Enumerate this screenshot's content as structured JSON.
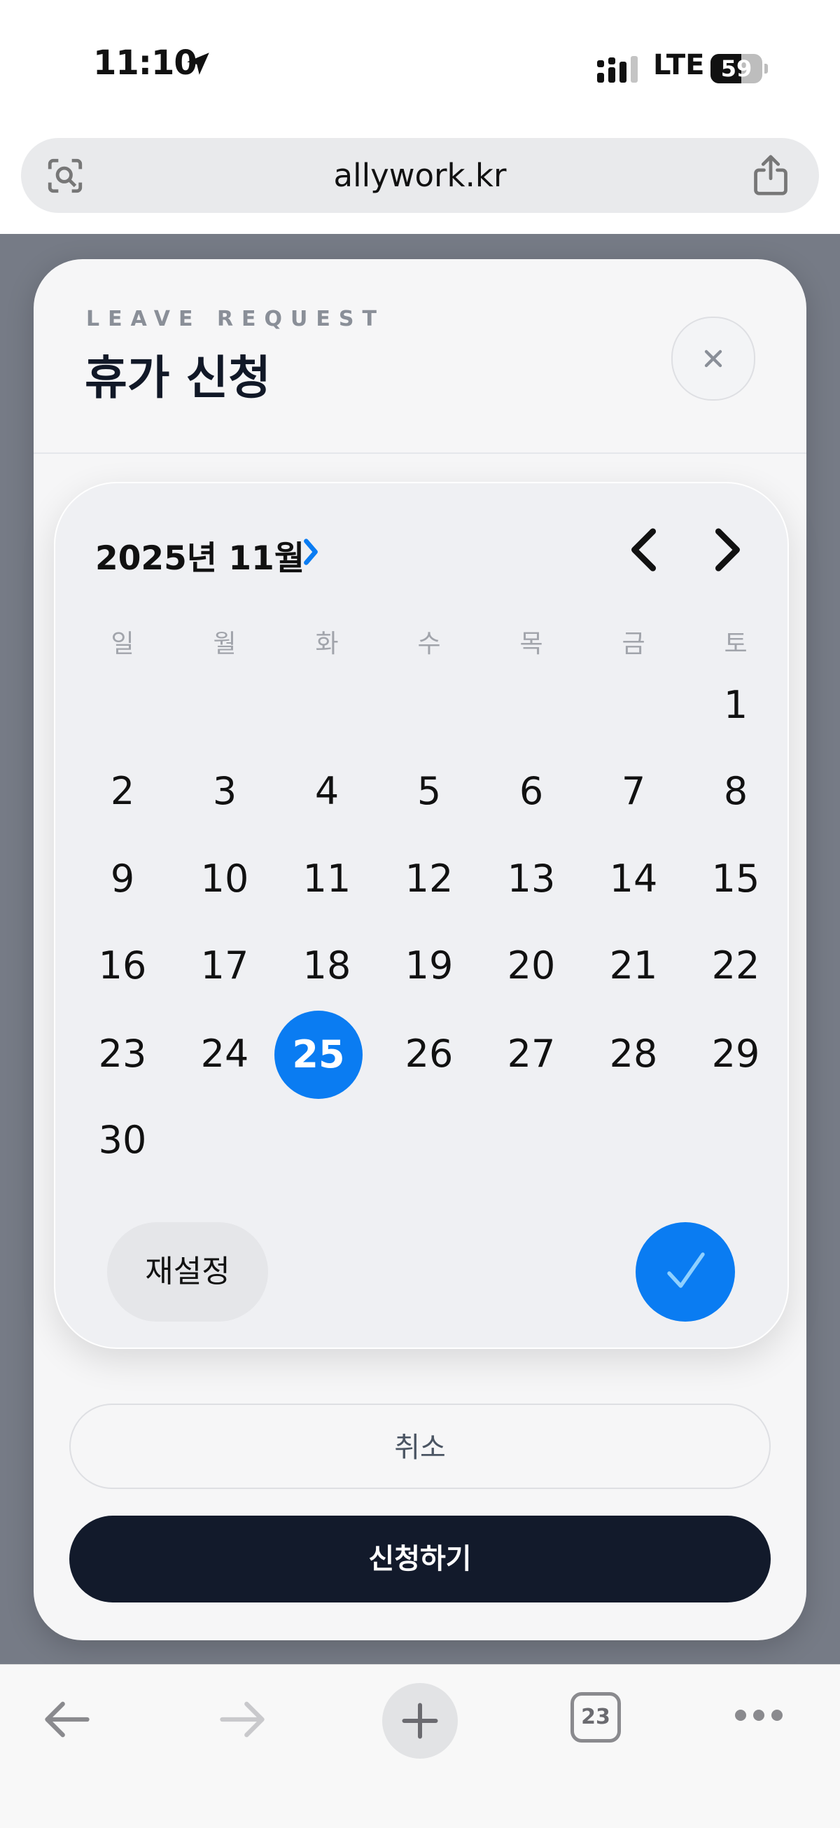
{
  "status_bar": {
    "time": "11:10",
    "network": "LTE",
    "battery": "59",
    "battery_level_percent": 59,
    "icons": [
      "location-arrow-icon",
      "signal-icon",
      "battery-icon"
    ]
  },
  "browser": {
    "url": "allywork.kr",
    "icons": [
      "visual-lookup-icon",
      "share-icon"
    ],
    "toolbar": {
      "tabs_count": "23",
      "icons": [
        "back-arrow-icon",
        "forward-arrow-icon",
        "plus-icon",
        "tabs-icon",
        "more-dots-icon"
      ]
    }
  },
  "modal": {
    "eyebrow": "LEAVE REQUEST",
    "title": "휴가 신청",
    "close_label": "×",
    "cancel_label": "취소",
    "submit_label": "신청하기"
  },
  "calendar": {
    "month_label": "2025년 11월",
    "weekdays": [
      "일",
      "월",
      "화",
      "수",
      "목",
      "금",
      "토"
    ],
    "days": [
      "1",
      "2",
      "3",
      "4",
      "5",
      "6",
      "7",
      "8",
      "9",
      "10",
      "11",
      "12",
      "13",
      "14",
      "15",
      "16",
      "17",
      "18",
      "19",
      "20",
      "21",
      "22",
      "23",
      "24",
      "25",
      "26",
      "27",
      "28",
      "29",
      "30"
    ],
    "selected_day": "25",
    "reset_label": "재설정",
    "icons": [
      "chevron-right-icon",
      "chevron-left-icon",
      "checkmark-icon"
    ]
  },
  "colors": {
    "accent": "#0a7cf2",
    "submit_bg": "#121a2b",
    "backdrop": "#767b86"
  }
}
